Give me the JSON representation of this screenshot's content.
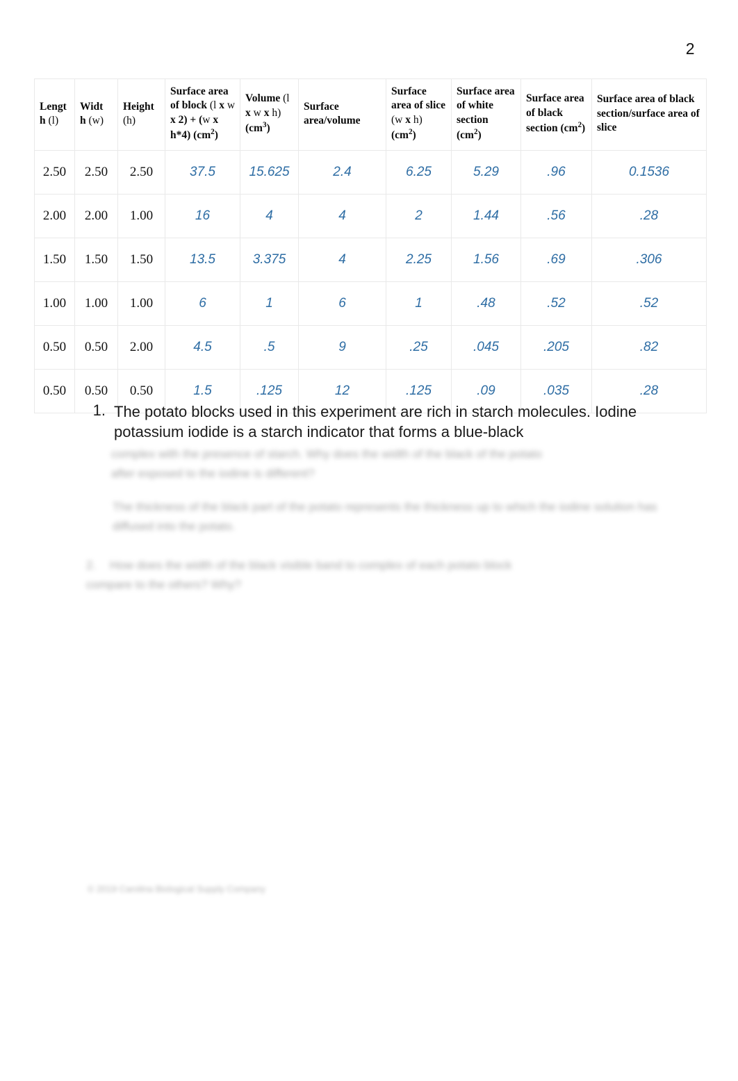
{
  "page": {
    "number": "2"
  },
  "table": {
    "columns": [
      {
        "key": "length",
        "label_bold": "Lengt h (",
        "label_light": "l",
        "label_tail": ")"
      },
      {
        "key": "width",
        "label_bold": "Widt h (",
        "label_light": "w",
        "label_tail": ")"
      },
      {
        "key": "height",
        "label_bold": "Height",
        "label_light": " (h)",
        "label_tail": ""
      },
      {
        "key": "sa_block",
        "label": "Surface area of block (l x w x 2) + (w x h*4) (cm²)"
      },
      {
        "key": "volume",
        "label": "Volume (l x w x h) (cm³)"
      },
      {
        "key": "sa_vol",
        "label": "Surface area/volume"
      },
      {
        "key": "sa_slice",
        "label": "Surface area of slice (w x h) (cm²)"
      },
      {
        "key": "sa_white",
        "label": "Surface area of white section (cm²)"
      },
      {
        "key": "sa_black",
        "label": "Surface area of black section (cm²)"
      },
      {
        "key": "ratio",
        "label": "Surface area of black section/surface area of slice"
      }
    ],
    "rows": [
      {
        "length": "2.50",
        "width": "2.50",
        "height": "2.50",
        "sa_block": "37.5",
        "volume": "15.625",
        "sa_vol": "2.4",
        "sa_slice": "6.25",
        "sa_white": "5.29",
        "sa_black": ".96",
        "ratio": "0.1536"
      },
      {
        "length": "2.00",
        "width": "2.00",
        "height": "1.00",
        "sa_block": "16",
        "volume": "4",
        "sa_vol": "4",
        "sa_slice": "2",
        "sa_white": "1.44",
        "sa_black": ".56",
        "ratio": ".28"
      },
      {
        "length": "1.50",
        "width": "1.50",
        "height": "1.50",
        "sa_block": "13.5",
        "volume": "3.375",
        "sa_vol": "4",
        "sa_slice": "2.25",
        "sa_white": "1.56",
        "sa_black": ".69",
        "ratio": ".306"
      },
      {
        "length": "1.00",
        "width": "1.00",
        "height": "1.00",
        "sa_block": "6",
        "volume": "1",
        "sa_vol": "6",
        "sa_slice": "1",
        "sa_white": ".48",
        "sa_black": ".52",
        "ratio": ".52"
      },
      {
        "length": "0.50",
        "width": "0.50",
        "height": "2.00",
        "sa_block": "4.5",
        "volume": ".5",
        "sa_vol": "9",
        "sa_slice": ".25",
        "sa_white": ".045",
        "sa_black": ".205",
        "ratio": ".82"
      },
      {
        "length": "0.50",
        "width": "0.50",
        "height": "0.50",
        "sa_block": "1.5",
        "volume": ".125",
        "sa_vol": "12",
        "sa_slice": ".125",
        "sa_white": ".09",
        "sa_black": ".035",
        "ratio": ".28"
      }
    ]
  },
  "questions": [
    {
      "marker": "1.",
      "text": "The potato blocks used in this experiment are rich in starch molecules. Iodine potassium iodide is a starch indicator that forms a blue-black"
    }
  ],
  "obscured": {
    "paragraph_1": "complex with the presence of starch. Why does the width of the black of the potato after exposed to the iodine is different?",
    "paragraph_2": "The thickness of the black part of the potato represents the thickness up to which the iodine solution has diffused into the potato.",
    "question_2_marker": "2.",
    "question_2": "How does the width of the black visible band to complex of each potato block compare to the others? Why?",
    "footer": "© 2019 Carolina Biological Supply Company"
  },
  "colors": {
    "calculated_value": "#2e6da4",
    "table_border": "#e9e9e9",
    "body_text": "#1a1a1a"
  }
}
